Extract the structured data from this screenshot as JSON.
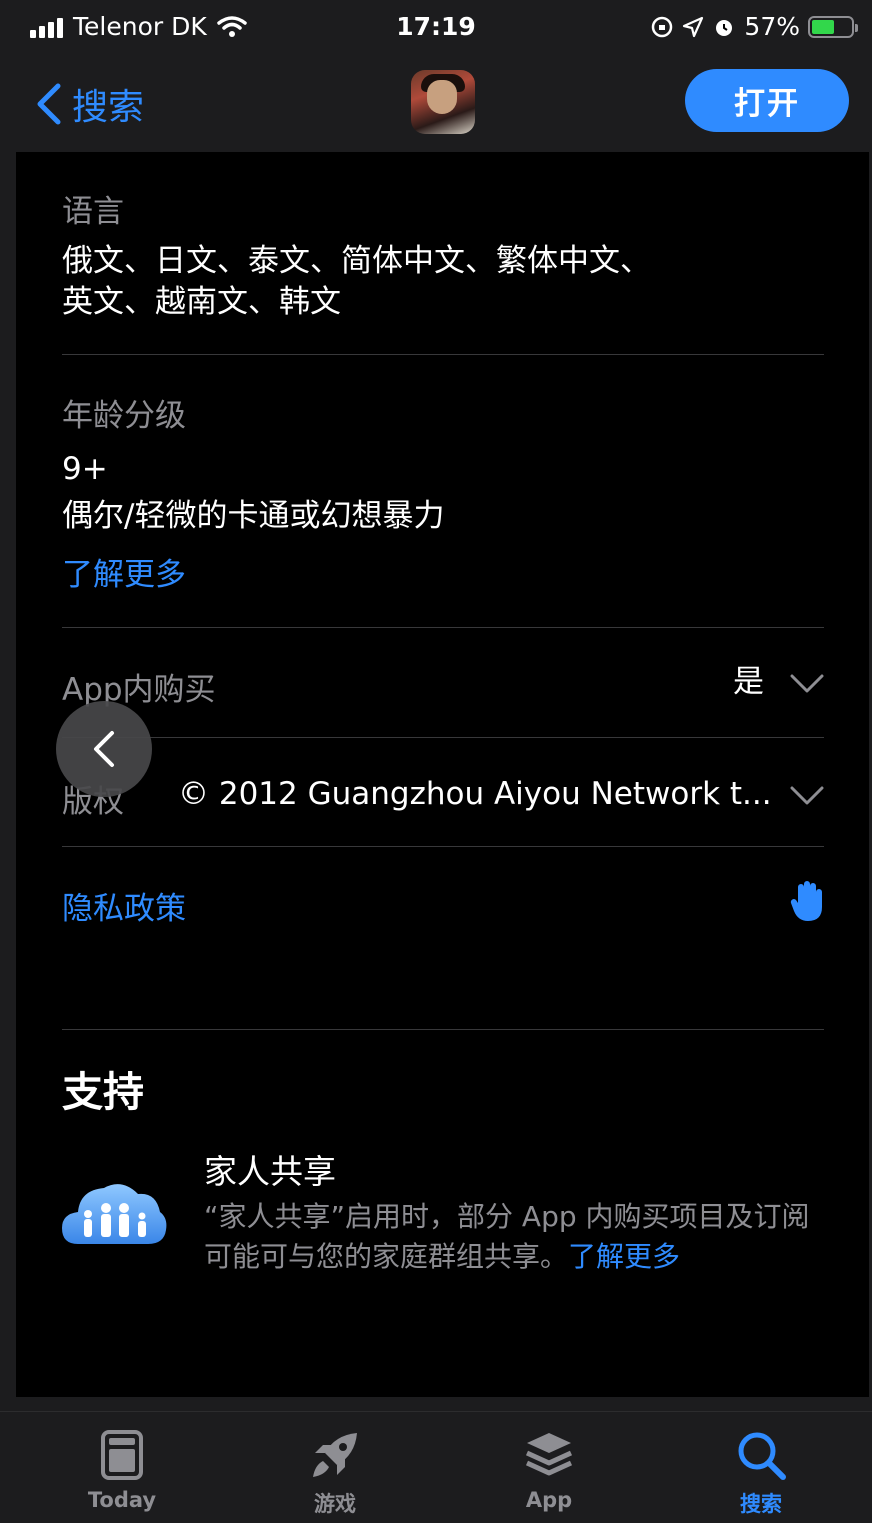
{
  "status_bar": {
    "carrier": "Telenor DK",
    "time": "17:19",
    "battery_percent": "57%",
    "battery_level": 0.57
  },
  "nav": {
    "back_label": "搜索",
    "open_button": "打开"
  },
  "info": {
    "language": {
      "label": "语言",
      "value_line1": "俄文、日文、泰文、简体中文、繁体中文、",
      "value_line2": "英文、越南文、韩文"
    },
    "age_rating": {
      "label": "年龄分级",
      "rating": "9+",
      "description": "偶尔/轻微的卡通或幻想暴力",
      "learn_more": "了解更多"
    },
    "in_app_purchase": {
      "label": "App内购买",
      "value": "是"
    },
    "copyright": {
      "label": "版权",
      "value": "© 2012 Guangzhou Aiyou Network t..."
    },
    "privacy_policy": "隐私政策"
  },
  "support": {
    "title": "支持",
    "family_sharing_title": "家人共享",
    "family_sharing_desc": "“家人共享”启用时，部分 App 内购买项目及订阅可能可与您的家庭群组共享。",
    "family_sharing_link": "了解更多"
  },
  "tabs": [
    {
      "label": "Today",
      "icon": "today-icon",
      "active": false
    },
    {
      "label": "游戏",
      "icon": "rocket-icon",
      "active": false
    },
    {
      "label": "App",
      "icon": "layers-icon",
      "active": false
    },
    {
      "label": "搜索",
      "icon": "search-icon",
      "active": true
    }
  ],
  "colors": {
    "accent": "#2f8bff",
    "background": "#000000",
    "secondary_text": "#8e8e93",
    "bar_background": "#1c1c1e"
  }
}
